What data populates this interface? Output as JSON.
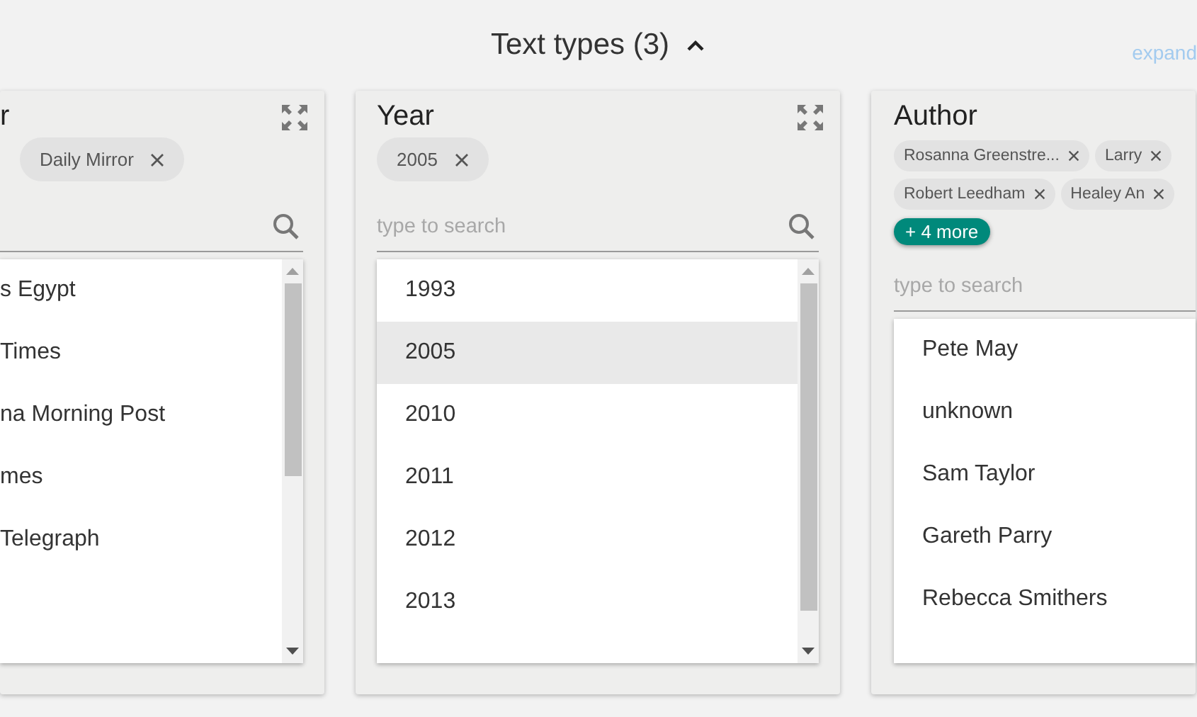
{
  "header": {
    "title": "Text types (3)",
    "expanded": true,
    "expand_link": "expand"
  },
  "panels": [
    {
      "title": "r",
      "chips": [
        {
          "label": "Daily Mirror"
        }
      ],
      "items": [
        {
          "label": "s Egypt",
          "selected": false
        },
        {
          "label": "Times",
          "selected": false
        },
        {
          "label": "na Morning Post",
          "selected": false
        },
        {
          "label": "mes",
          "selected": false
        },
        {
          "label": "Telegraph",
          "selected": false
        }
      ]
    },
    {
      "title": "Year",
      "chips": [
        {
          "label": "2005"
        }
      ],
      "search": {
        "placeholder": "type to search"
      },
      "items": [
        {
          "label": "1993",
          "selected": false
        },
        {
          "label": "2005",
          "selected": true
        },
        {
          "label": "2010",
          "selected": false
        },
        {
          "label": "2011",
          "selected": false
        },
        {
          "label": "2012",
          "selected": false
        },
        {
          "label": "2013",
          "selected": false
        }
      ]
    },
    {
      "title": "Author",
      "chips": [
        {
          "label": "Rosanna Greenstre..."
        },
        {
          "label": "Larry"
        },
        {
          "label": "Robert Leedham"
        },
        {
          "label": "Healey An"
        }
      ],
      "more": "+ 4 more",
      "search": {
        "placeholder": "type to search"
      },
      "items": [
        {
          "label": "Pete May",
          "selected": false
        },
        {
          "label": "unknown",
          "selected": false
        },
        {
          "label": "Sam Taylor",
          "selected": false
        },
        {
          "label": "Gareth Parry",
          "selected": false
        },
        {
          "label": "Rebecca Smithers",
          "selected": false
        }
      ]
    }
  ]
}
